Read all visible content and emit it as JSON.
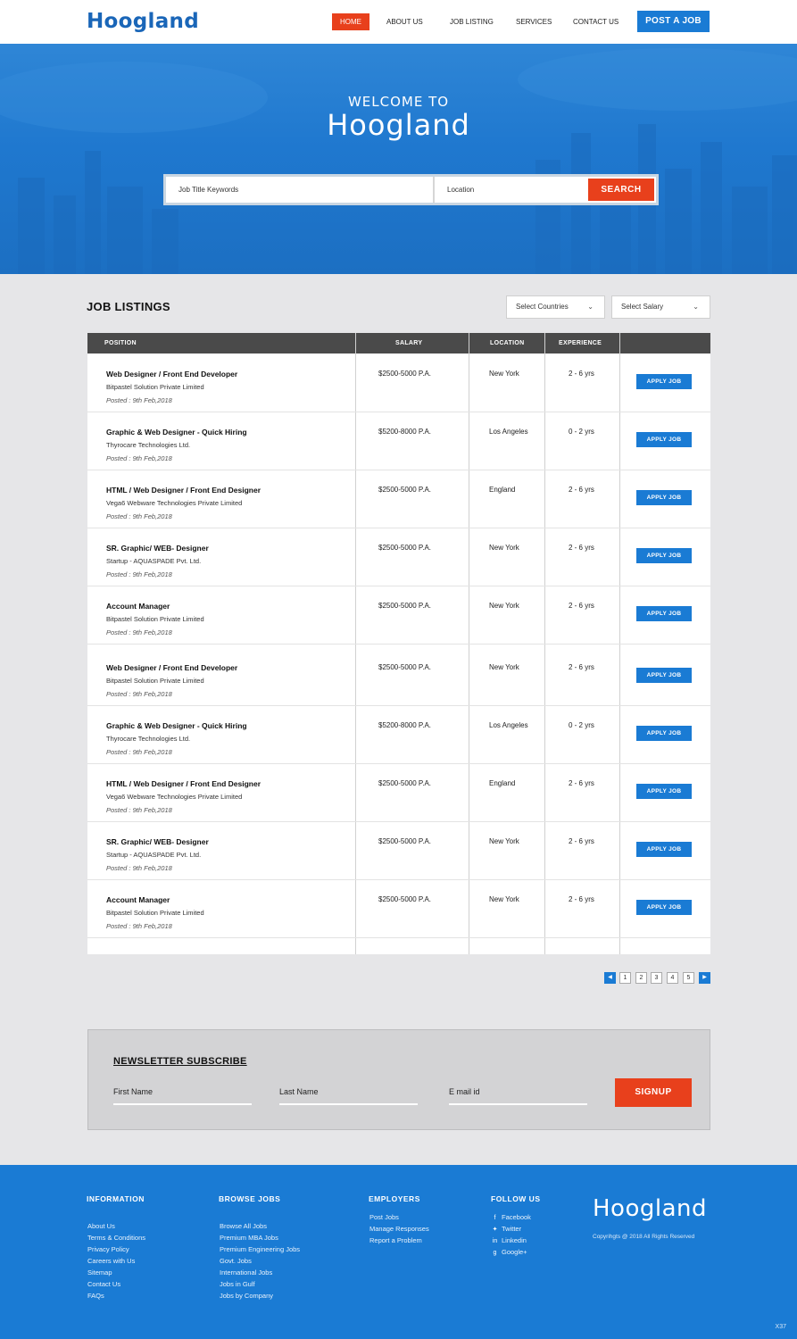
{
  "brand": {
    "name": "Hoogland"
  },
  "nav": {
    "items": [
      "HOME",
      "ABOUT US",
      "JOB LISTING",
      "SERVICES",
      "CONTACT US"
    ],
    "post_job": "POST A JOB"
  },
  "hero": {
    "welcome": "WELCOME TO",
    "title": "Hoogland",
    "keyword_placeholder": "Job Title Keywords",
    "location_placeholder": "Location",
    "search_label": "SEARCH"
  },
  "listings": {
    "title": "JOB LISTINGS",
    "country_select": "Select Countries",
    "salary_select": "Select Salary",
    "columns": [
      "POSITION",
      "SALARY",
      "LOCATION",
      "EXPERIENCE"
    ],
    "apply_label": "APPLY JOB",
    "jobs": [
      {
        "title": "Web Designer / Front End Developer",
        "company": "Bitpastel Solution Private Limited",
        "posted": "Posted : 9th Feb,2018",
        "salary": "$2500-5000 P.A.",
        "location": "New York",
        "experience": "2 - 6 yrs"
      },
      {
        "title": "Graphic & Web Designer - Quick Hiring",
        "company": "Thyrocare Technologies Ltd.",
        "posted": "Posted : 9th Feb,2018",
        "salary": "$5200-8000 P.A.",
        "location": "Los Angeles",
        "experience": "0 - 2 yrs"
      },
      {
        "title": "HTML / Web Designer / Front End Designer",
        "company": "Vega6 Webware Technologies Private Limited",
        "posted": "Posted : 9th Feb,2018",
        "salary": "$2500-5000 P.A.",
        "location": "England",
        "experience": "2 - 6 yrs"
      },
      {
        "title": "SR. Graphic/ WEB- Designer",
        "company": "Startup - AQUASPADE Pvt. Ltd.",
        "posted": "Posted : 9th Feb,2018",
        "salary": "$2500-5000 P.A.",
        "location": "New York",
        "experience": "2 - 6 yrs"
      },
      {
        "title": "Account Manager",
        "company": "Bitpastel Solution Private Limited",
        "posted": "Posted : 9th Feb,2018",
        "salary": "$2500-5000 P.A.",
        "location": "New York",
        "experience": "2 - 6 yrs"
      },
      {
        "title": "Web Designer / Front End Developer",
        "company": "Bitpastel Solution Private Limited",
        "posted": "Posted : 9th Feb,2018",
        "salary": "$2500-5000 P.A.",
        "location": "New York",
        "experience": "2 - 6 yrs"
      },
      {
        "title": "Graphic & Web Designer - Quick Hiring",
        "company": "Thyrocare Technologies Ltd.",
        "posted": "Posted : 9th Feb,2018",
        "salary": "$5200-8000 P.A.",
        "location": "Los Angeles",
        "experience": "0 - 2 yrs"
      },
      {
        "title": "HTML / Web Designer / Front End Designer",
        "company": "Vega6 Webware Technologies Private Limited",
        "posted": "Posted : 9th Feb,2018",
        "salary": "$2500-5000 P.A.",
        "location": "England",
        "experience": "2 - 6 yrs"
      },
      {
        "title": "SR. Graphic/ WEB- Designer",
        "company": "Startup - AQUASPADE Pvt. Ltd.",
        "posted": "Posted : 9th Feb,2018",
        "salary": "$2500-5000 P.A.",
        "location": "New York",
        "experience": "2 - 6 yrs"
      },
      {
        "title": "Account Manager",
        "company": "Bitpastel Solution Private Limited",
        "posted": "Posted : 9th Feb,2018",
        "salary": "$2500-5000 P.A.",
        "location": "New York",
        "experience": "2 - 6 yrs"
      }
    ]
  },
  "pagination": {
    "pages": [
      "1",
      "2",
      "3",
      "4",
      "5"
    ],
    "prev_icon": "chevron-left-icon",
    "next_icon": "chevron-right-icon"
  },
  "newsletter": {
    "title": "NEWSLETTER SUBSCRIBE",
    "first_name": "First Name",
    "last_name": "Last Name",
    "email": "E mail id",
    "signup": "SIGNUP"
  },
  "footer": {
    "information": {
      "heading": "INFORMATION",
      "links": [
        "About Us",
        "Terms & Conditions",
        "Privacy Policy",
        "Careers with Us",
        "Sitemap",
        "Contact Us",
        "FAQs"
      ]
    },
    "browse": {
      "heading": "BROWSE JOBS",
      "links": [
        "Browse All Jobs",
        "Premium MBA Jobs",
        "Premium Engineering Jobs",
        "Govt. Jobs",
        "International Jobs",
        "Jobs in Gulf",
        "Jobs by Company"
      ]
    },
    "employers": {
      "heading": "EMPLOYERS",
      "links": [
        "Post Jobs",
        "Manage Responses",
        "Report a Problem"
      ]
    },
    "follow": {
      "heading": "FOLLOW US",
      "links": [
        {
          "label": "Facebook",
          "icon": "facebook-icon"
        },
        {
          "label": "Twitter",
          "icon": "twitter-icon"
        },
        {
          "label": "Linkedin",
          "icon": "linkedin-icon"
        },
        {
          "label": "Google+",
          "icon": "google-plus-icon"
        }
      ]
    },
    "logo": "Hoogland",
    "copyright": "Copyrihgts @ 2018 All Rights Reserved",
    "corner": "X37"
  },
  "colors": {
    "primary_blue": "#1a7bd4",
    "accent_orange": "#e8401c",
    "table_header": "#4a4a4a"
  }
}
